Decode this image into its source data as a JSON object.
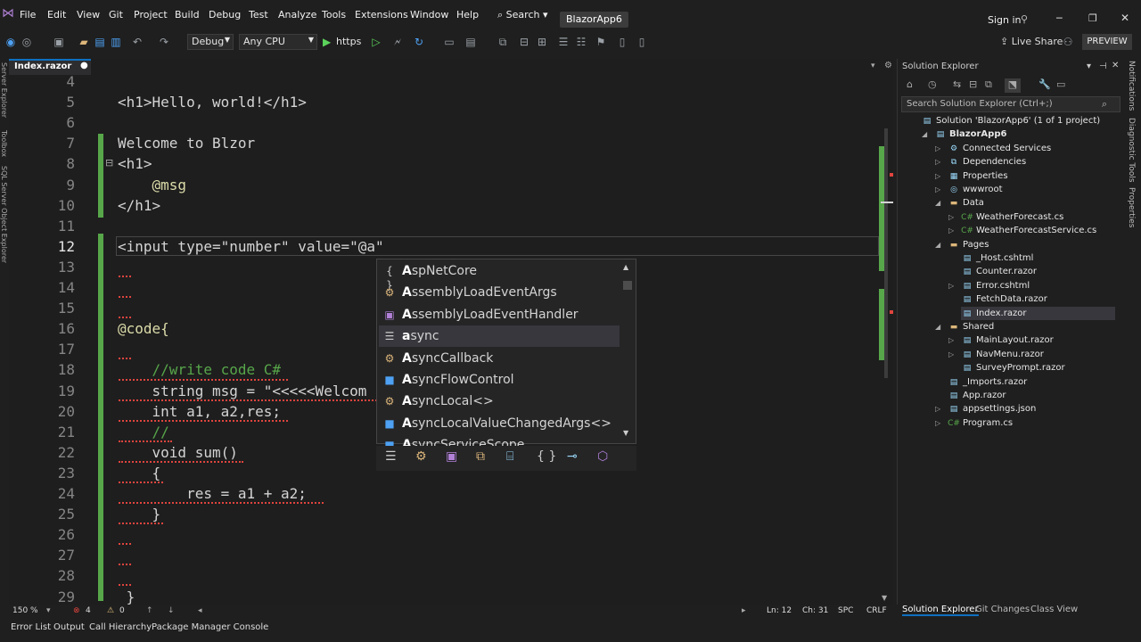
{
  "menu": [
    "File",
    "Edit",
    "View",
    "Git",
    "Project",
    "Build",
    "Debug",
    "Test",
    "Analyze",
    "Tools",
    "Extensions",
    "Window",
    "Help"
  ],
  "search_label": "Search",
  "solution_badge": "BlazorApp6",
  "sign_in": "Sign in",
  "toolbar": {
    "config": "Debug",
    "platform": "Any CPU",
    "run_label": "https",
    "live_share": "Live Share",
    "preview": "PREVIEW"
  },
  "left_tabs": [
    "Server Explorer",
    "Toolbox",
    "SQL Server Object Explorer"
  ],
  "doc_tab": "Index.razor",
  "editor": {
    "line_numbers": [
      "4",
      "5",
      "6",
      "7",
      "8",
      "9",
      "10",
      "11",
      "12",
      "13",
      "14",
      "15",
      "16",
      "17",
      "18",
      "19",
      "20",
      "21",
      "22",
      "23",
      "24",
      "25",
      "26",
      "27",
      "28",
      "29"
    ],
    "lines": [
      "",
      "<h1>Hello, world!</h1>",
      "",
      "Welcome to Blzor",
      "<h1>",
      "    @msg",
      "</h1>",
      "",
      "<input type=\"number\" value=\"@a\"",
      "",
      "",
      "",
      "@code{",
      "",
      "    //write code C#",
      "    string msg = \"<<<<<Welcom",
      "    int a1, a2,res;",
      "    //",
      "    void sum()",
      "    {",
      "        res = a1 + a2;",
      "    }",
      "",
      "",
      "",
      " }"
    ]
  },
  "completion": {
    "items": [
      {
        "bold": "A",
        "rest": "spNetCore",
        "icon": "{ }",
        "icon_name": "namespace-icon"
      },
      {
        "bold": "A",
        "rest": "ssemblyLoadEventArgs",
        "icon": "⚙",
        "icon_name": "class-icon"
      },
      {
        "bold": "A",
        "rest": "ssemblyLoadEventHandler",
        "icon": "▣",
        "icon_name": "delegate-icon"
      },
      {
        "bold": "a",
        "rest": "sync",
        "icon": "☰",
        "icon_name": "keyword-icon"
      },
      {
        "bold": "A",
        "rest": "syncCallback",
        "icon": "⚙",
        "icon_name": "struct-icon"
      },
      {
        "bold": "A",
        "rest": "syncFlowControl",
        "icon": "■",
        "icon_name": "struct-icon"
      },
      {
        "bold": "A",
        "rest": "syncLocal<>",
        "icon": "⚙",
        "icon_name": "class-icon"
      },
      {
        "bold": "A",
        "rest": "syncLocalValueChangedArgs<>",
        "icon": "■",
        "icon_name": "struct-icon"
      },
      {
        "bold": "A",
        "rest": "syncServiceScope",
        "icon": "■",
        "icon_name": "struct-icon"
      }
    ],
    "filters": [
      "☰",
      "⚙",
      "▣",
      "⧉",
      "⌸",
      "{ }",
      "⊸",
      "⬡"
    ]
  },
  "solution_explorer": {
    "title": "Solution Explorer",
    "search_placeholder": "Search Solution Explorer (Ctrl+;)",
    "tree": [
      {
        "label": "Solution 'BlazorApp6' (1 of 1 project)",
        "depth": 0,
        "icon": "▤",
        "expander": ""
      },
      {
        "label": "BlazorApp6",
        "depth": 1,
        "icon": "▤",
        "expander": "◢",
        "bold": true
      },
      {
        "label": "Connected Services",
        "depth": 2,
        "icon": "⚙",
        "expander": "▷"
      },
      {
        "label": "Dependencies",
        "depth": 2,
        "icon": "⧉",
        "expander": "▷"
      },
      {
        "label": "Properties",
        "depth": 2,
        "icon": "▦",
        "expander": "▷"
      },
      {
        "label": "wwwroot",
        "depth": 2,
        "icon": "◎",
        "expander": "▷"
      },
      {
        "label": "Data",
        "depth": 2,
        "icon": "▬",
        "expander": "◢"
      },
      {
        "label": "WeatherForecast.cs",
        "depth": 3,
        "icon": "C#",
        "expander": "▷"
      },
      {
        "label": "WeatherForecastService.cs",
        "depth": 3,
        "icon": "C#",
        "expander": "▷"
      },
      {
        "label": "Pages",
        "depth": 2,
        "icon": "▬",
        "expander": "◢"
      },
      {
        "label": "_Host.cshtml",
        "depth": 3,
        "icon": "▤",
        "expander": ""
      },
      {
        "label": "Counter.razor",
        "depth": 3,
        "icon": "▤",
        "expander": ""
      },
      {
        "label": "Error.cshtml",
        "depth": 3,
        "icon": "▤",
        "expander": "▷"
      },
      {
        "label": "FetchData.razor",
        "depth": 3,
        "icon": "▤",
        "expander": ""
      },
      {
        "label": "Index.razor",
        "depth": 3,
        "icon": "▤",
        "expander": "",
        "selected": true
      },
      {
        "label": "Shared",
        "depth": 2,
        "icon": "▬",
        "expander": "◢"
      },
      {
        "label": "MainLayout.razor",
        "depth": 3,
        "icon": "▤",
        "expander": "▷"
      },
      {
        "label": "NavMenu.razor",
        "depth": 3,
        "icon": "▤",
        "expander": "▷"
      },
      {
        "label": "SurveyPrompt.razor",
        "depth": 3,
        "icon": "▤",
        "expander": ""
      },
      {
        "label": "_Imports.razor",
        "depth": 2,
        "icon": "▤",
        "expander": ""
      },
      {
        "label": "App.razor",
        "depth": 2,
        "icon": "▤",
        "expander": ""
      },
      {
        "label": "appsettings.json",
        "depth": 2,
        "icon": "▤",
        "expander": "▷"
      },
      {
        "label": "Program.cs",
        "depth": 2,
        "icon": "C#",
        "expander": "▷"
      }
    ],
    "tabs": [
      "Solution Explorer",
      "Git Changes",
      "Class View"
    ]
  },
  "right_strip": [
    "Notifications",
    "Diagnostic Tools",
    "Properties"
  ],
  "status": {
    "zoom": "150 %",
    "errors": "4",
    "warnings": "0",
    "line": "Ln: 12",
    "col": "Ch: 31",
    "spc": "SPC",
    "crlf": "CRLF"
  },
  "bottom_tabs": [
    "Error List",
    "Output",
    "Call Hierarchy",
    "Package Manager Console"
  ],
  "colors": {
    "tag": "#808080",
    "element": "#569cd6",
    "attr": "#9cdcfe",
    "string": "#ce9178",
    "comment": "#57a64a",
    "keyword": "#569cd6",
    "razor": "#dcdcaa",
    "accent": "#0e70c0"
  }
}
